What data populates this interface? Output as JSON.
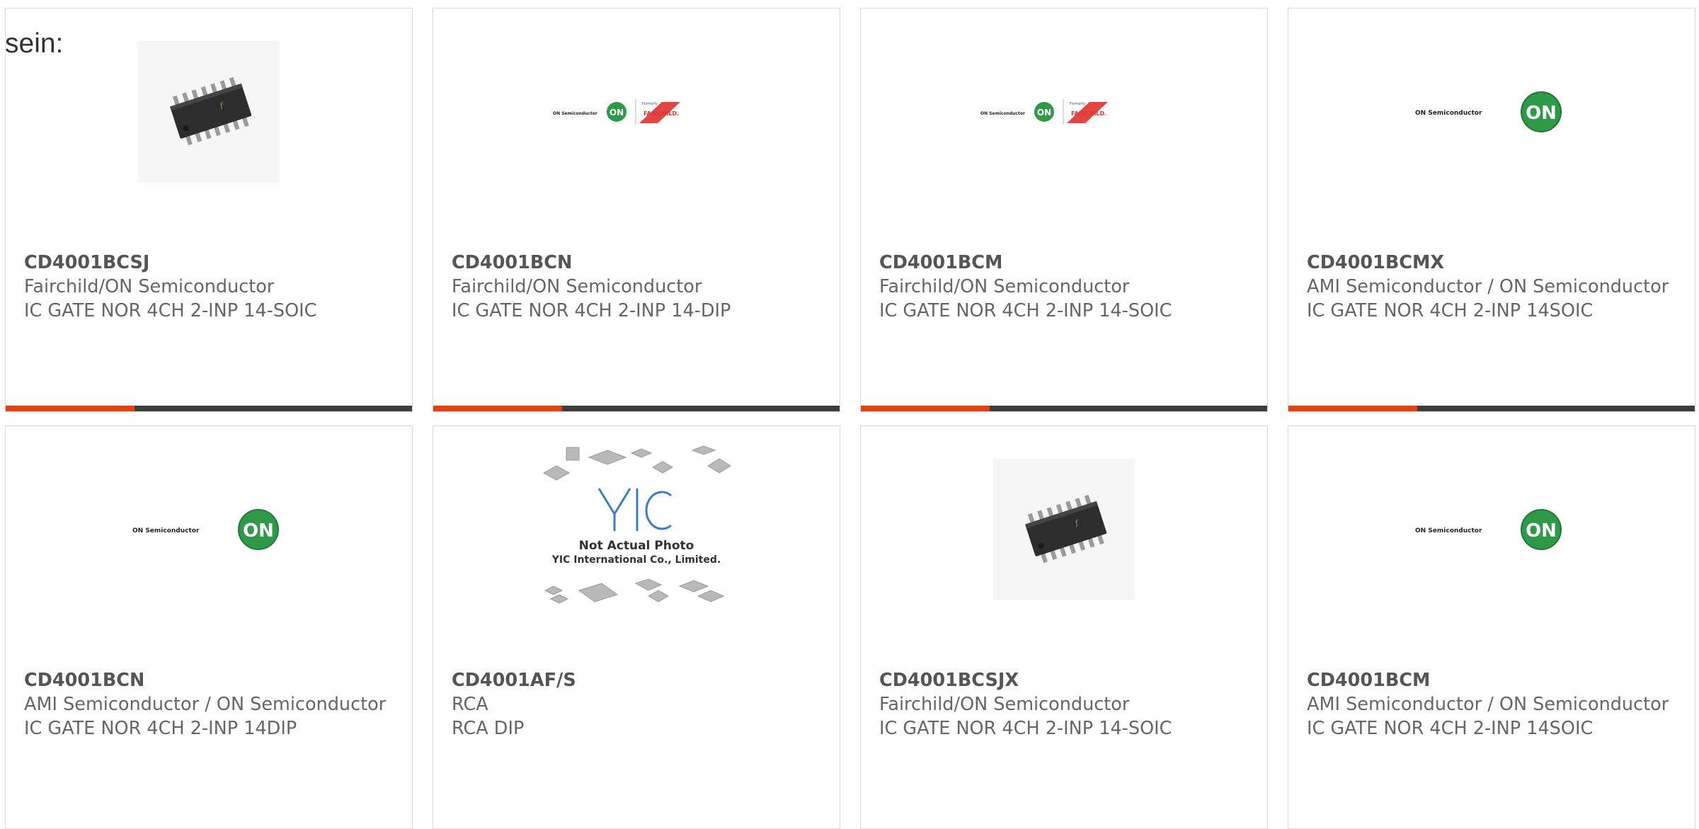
{
  "page": {
    "prefix_text": "sein:"
  },
  "colors": {
    "accent_bar": "#e8400c",
    "dark_bar": "#3d3d3d",
    "on_green": "#2e9a48",
    "fairchild_red": "#e0322e",
    "card_border": "#d9d9d9"
  },
  "cards": [
    {
      "part_number": "CD4001BCSJ",
      "manufacturer": "Fairchild/ON Semiconductor",
      "description": "IC GATE NOR 4CH 2-INP 14-SOIC",
      "image": "soic-chip-photo"
    },
    {
      "part_number": "CD4001BCN",
      "manufacturer": "Fairchild/ON Semiconductor",
      "description": "IC GATE NOR 4CH 2-INP 14-DIP",
      "image": "on-fairchild-logo",
      "logo": {
        "brand": "ON Semiconductor",
        "mark": "ON",
        "formerly": "Formerly",
        "former_brand": "FAIRCHILD."
      }
    },
    {
      "part_number": "CD4001BCM",
      "manufacturer": "Fairchild/ON Semiconductor",
      "description": "IC GATE NOR 4CH 2-INP 14-SOIC",
      "image": "on-fairchild-logo",
      "logo": {
        "brand": "ON Semiconductor",
        "mark": "ON",
        "formerly": "Formerly",
        "former_brand": "FAIRCHILD."
      }
    },
    {
      "part_number": "CD4001BCMX",
      "manufacturer": "AMI Semiconductor / ON Semiconductor",
      "description": "IC GATE NOR 4CH 2-INP 14SOIC",
      "image": "on-semiconductor-logo",
      "logo": {
        "brand": "ON Semiconductor",
        "mark": "ON"
      }
    },
    {
      "part_number": "CD4001BCN",
      "manufacturer": "AMI Semiconductor / ON Semiconductor",
      "description": "IC GATE NOR 4CH 2-INP 14DIP",
      "image": "on-semiconductor-logo",
      "logo": {
        "brand": "ON Semiconductor",
        "mark": "ON"
      }
    },
    {
      "part_number": "CD4001AF/S",
      "manufacturer": "RCA",
      "description": "RCA DIP",
      "image": "not-actual-photo-placeholder",
      "placeholder": {
        "mark": "YIC",
        "line1": "Not Actual Photo",
        "line2": "YIC International Co., Limited."
      }
    },
    {
      "part_number": "CD4001BCSJX",
      "manufacturer": "Fairchild/ON Semiconductor",
      "description": "IC GATE NOR 4CH 2-INP 14-SOIC",
      "image": "soic-chip-photo"
    },
    {
      "part_number": "CD4001BCM",
      "manufacturer": "AMI Semiconductor / ON Semiconductor",
      "description": "IC GATE NOR 4CH 2-INP 14SOIC",
      "image": "on-semiconductor-logo",
      "logo": {
        "brand": "ON Semiconductor",
        "mark": "ON"
      }
    }
  ]
}
